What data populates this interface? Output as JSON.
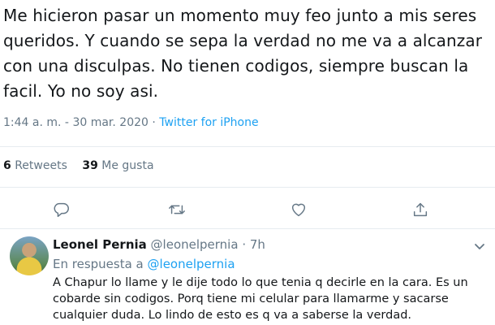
{
  "tweet": {
    "text": "Me hicieron pasar un momento muy feo junto a mis seres queridos. Y cuando se sepa la verdad no me va a alcanzar con una disculpas. No tienen codigos, siempre buscan la facil. Yo no soy asi.",
    "time": "1:44 a. m.",
    "separator": "·",
    "date": "30 mar. 2020",
    "source": "Twitter for iPhone"
  },
  "stats": {
    "retweets_count": "6",
    "retweets_label": "Retweets",
    "likes_count": "39",
    "likes_label": "Me gusta"
  },
  "actions": [
    {
      "icon": "reply-icon"
    },
    {
      "icon": "retweet-icon"
    },
    {
      "icon": "like-icon"
    },
    {
      "icon": "share-icon"
    }
  ],
  "reply": {
    "name": "Leonel Pernia",
    "handle": "@leonelpernia",
    "separator": "·",
    "time": "7h",
    "reply_to_label": "En respuesta a",
    "reply_to_handle": "@leonelpernia",
    "text": "A Chapur lo llame y le dije todo lo que tenia q decirle en la cara. Es un cobarde sin codigos. Porq tiene mi celular para llamarme y sacarse cualquier duda. Lo lindo de esto es q va a saberse la verdad."
  },
  "colors": {
    "link": "#1da1f2",
    "muted": "#657786",
    "text": "#14171a"
  }
}
